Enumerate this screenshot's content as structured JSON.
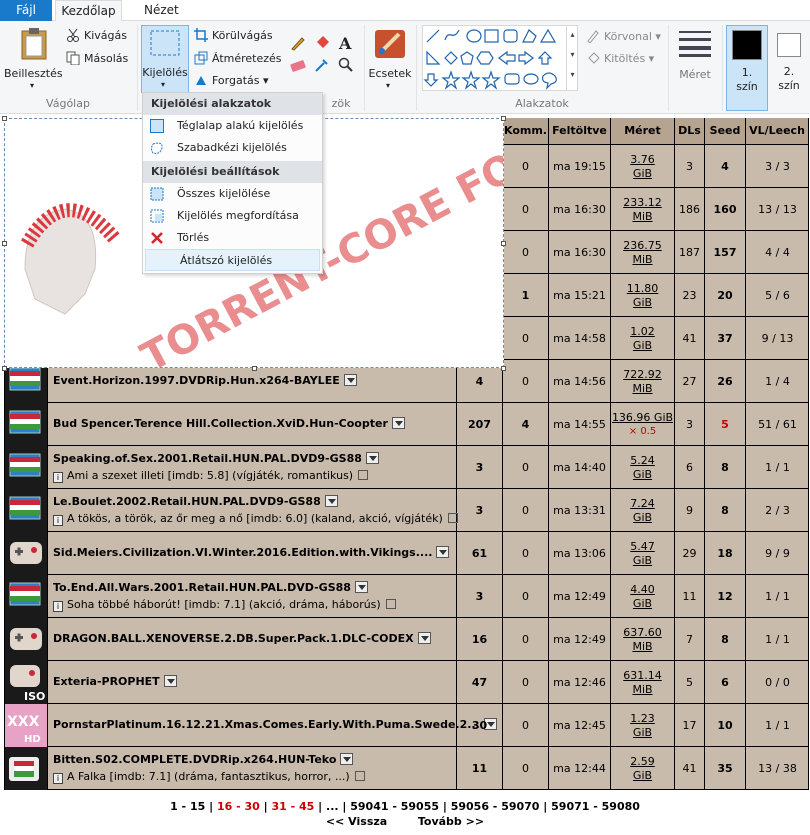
{
  "ribbon": {
    "tabs": [
      "Fájl",
      "Kezdőlap",
      "Nézet"
    ],
    "groups": {
      "clipboard": "Vágólap",
      "shapes": "Alakzatok",
      "tools_partial": "zök"
    },
    "paste": "Beillesztés",
    "cut": "Kivágás",
    "copy": "Másolás",
    "select": "Kijelölés",
    "crop": "Körülvágás",
    "resize": "Átméretezés",
    "rotate": "Forgatás",
    "brushes": "Ecsetek",
    "outline": "Körvonal",
    "fill": "Kitöltés",
    "size": "Méret",
    "color1": "1. szín",
    "color2": "2. szín"
  },
  "menu": {
    "header1": "Kijelölési alakzatok",
    "rect": "Téglalap alakú kijelölés",
    "free": "Szabadkézi kijelölés",
    "header2": "Kijelölési beállítások",
    "all": "Összes kijelölése",
    "invert": "Kijelölés megfordítása",
    "delete": "Törlés",
    "transparent": "Átlátszó kijelölés"
  },
  "watermark": "TORRENT-CORE FORUM",
  "table": {
    "headers": [
      "Komm.",
      "Feltöltve",
      "Méret",
      "DLs",
      "Seed",
      "VL/Leech"
    ],
    "rows": [
      {
        "name": "",
        "sub": "",
        "files": "",
        "comm": "0",
        "time": "ma 19:15",
        "size": "3.76",
        "unit": "GiB",
        "dls": "3",
        "seed": "4",
        "vl": "3 / 3",
        "cat": "hidden"
      },
      {
        "name": "",
        "sub": "",
        "files": "",
        "comm": "0",
        "time": "ma 16:30",
        "size": "233.12",
        "unit": "MiB",
        "dls": "186",
        "seed": "160",
        "vl": "13 / 13",
        "cat": "hidden"
      },
      {
        "name": "",
        "sub": "",
        "files": "",
        "comm": "0",
        "time": "ma 16:30",
        "size": "236.75",
        "unit": "MiB",
        "dls": "187",
        "seed": "157",
        "vl": "4 / 4",
        "cat": "hidden"
      },
      {
        "name": "",
        "sub": "",
        "files": "",
        "comm": "1",
        "time": "ma 15:21",
        "size": "11.80",
        "unit": "GiB",
        "dls": "23",
        "seed": "20",
        "vl": "5 / 6",
        "cat": "hidden"
      },
      {
        "name": "",
        "sub": "",
        "files": "",
        "comm": "0",
        "time": "ma 14:58",
        "size": "1.02",
        "unit": "GiB",
        "dls": "41",
        "seed": "37",
        "vl": "9 / 13",
        "cat": "hidden"
      },
      {
        "name": "Event.Horizon.1997.DVDRip.Hun.x264-BAYLEE",
        "sub": "",
        "files": "4",
        "comm": "0",
        "time": "ma 14:56",
        "size": "722.92",
        "unit": "MiB",
        "dls": "27",
        "seed": "26",
        "vl": "1 / 4",
        "cat": "movie"
      },
      {
        "name": "Bud Spencer.Terence Hill.Collection.XviD.Hun-Coopter",
        "sub": "",
        "files": "207",
        "comm": "4",
        "time": "ma 14:55",
        "size": "136.96 GiB",
        "unit": "× 0.5",
        "dls": "3",
        "seed": "5",
        "vl": "51 / 61",
        "cat": "movie"
      },
      {
        "name": "Speaking.of.Sex.2001.Retail.HUN.PAL.DVD9-GS88",
        "sub": "Ami a szexet illeti  [imdb: 5.8] (vígjáték, romantikus)",
        "files": "3",
        "comm": "0",
        "time": "ma 14:40",
        "size": "5.24",
        "unit": "GiB",
        "dls": "6",
        "seed": "8",
        "vl": "1 / 1",
        "cat": "movie"
      },
      {
        "name": "Le.Boulet.2002.Retail.HUN.PAL.DVD9-GS88",
        "sub": "A tökös, a török, az őr meg a nő  [imdb: 6.0] (kaland, akció, vígjáték)",
        "files": "3",
        "comm": "0",
        "time": "ma 13:31",
        "size": "7.24",
        "unit": "GiB",
        "dls": "9",
        "seed": "8",
        "vl": "2 / 3",
        "cat": "movie"
      },
      {
        "name": "Sid.Meiers.Civilization.VI.Winter.2016.Edition.with.Vikings....",
        "sub": "",
        "files": "61",
        "comm": "0",
        "time": "ma 13:06",
        "size": "5.47",
        "unit": "GiB",
        "dls": "29",
        "seed": "18",
        "vl": "9 / 9",
        "cat": "game"
      },
      {
        "name": "To.End.All.Wars.2001.Retail.HUN.PAL.DVD-GS88",
        "sub": "Soha többé háborút!  [imdb: 7.1] (akció, dráma, háborús)",
        "files": "3",
        "comm": "0",
        "time": "ma 12:49",
        "size": "4.40",
        "unit": "GiB",
        "dls": "11",
        "seed": "12",
        "vl": "1 / 1",
        "cat": "movie"
      },
      {
        "name": "DRAGON.BALL.XENOVERSE.2.DB.Super.Pack.1.DLC-CODEX",
        "sub": "",
        "files": "16",
        "comm": "0",
        "time": "ma 12:49",
        "size": "637.60",
        "unit": "MiB",
        "dls": "7",
        "seed": "8",
        "vl": "1 / 1",
        "cat": "game"
      },
      {
        "name": "Exteria-PROPHET",
        "sub": "",
        "files": "47",
        "comm": "0",
        "time": "ma 12:46",
        "size": "631.14",
        "unit": "MiB",
        "dls": "5",
        "seed": "6",
        "vl": "0 / 0",
        "cat": "iso"
      },
      {
        "name": "PornstarPlatinum.16.12.21.Xmas.Comes.Early.With.Puma.Swede.2...",
        "sub": "",
        "files": "30",
        "comm": "0",
        "time": "ma 12:45",
        "size": "1.23",
        "unit": "GiB",
        "dls": "17",
        "seed": "10",
        "vl": "1 / 1",
        "cat": "xxx"
      },
      {
        "name": "Bitten.S02.COMPLETE.DVDRip.x264.HUN-Teko",
        "sub": "A Falka  [imdb: 7.1] (dráma, fantasztikus, horror, ...)",
        "files": "11",
        "comm": "0",
        "time": "ma 12:44",
        "size": "2.59",
        "unit": "GiB",
        "dls": "41",
        "seed": "35",
        "vl": "13 / 38",
        "cat": "tv"
      }
    ]
  },
  "pager": {
    "p1": "1 - 15",
    "p2": "16 - 30",
    "p3": "31 - 45",
    "dots": "...",
    "p4": "59041 - 59055",
    "p5": "59056 - 59070",
    "p6": "59071 - 59080",
    "prev": "<< Vissza",
    "next": "Tovább >>"
  },
  "colors": {
    "accent": "#1979ca",
    "tableBg": "#c9bbab",
    "header": "#b6a390",
    "watermark": "#d9232a"
  }
}
